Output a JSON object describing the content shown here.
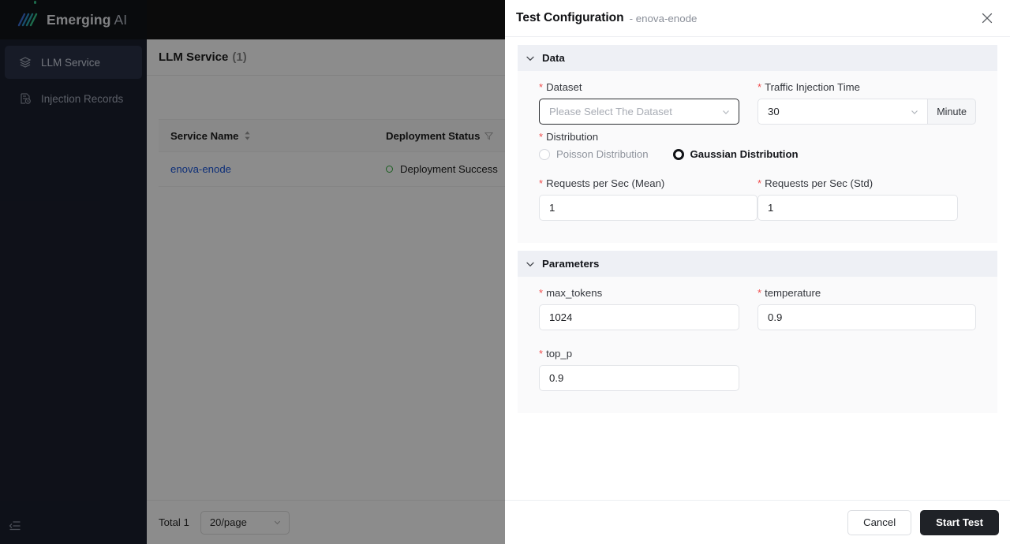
{
  "brand": {
    "name_bold": "Emerging",
    "name_light": "AI",
    "logo_icon": "slashes-logo-icon",
    "accent": "#35c58a"
  },
  "sidebar": {
    "items": [
      {
        "label": "LLM Service",
        "icon": "layers-icon",
        "active": true
      },
      {
        "label": "Injection Records",
        "icon": "document-clock-icon",
        "active": false
      }
    ],
    "collapse_icon": "sidebar-collapse-icon"
  },
  "page": {
    "title": "LLM Service",
    "count": "(1)",
    "table": {
      "columns": [
        {
          "label": "Service Name",
          "icon": "sort-icon"
        },
        {
          "label": "Deployment Status",
          "icon": "filter-icon"
        }
      ],
      "rows": [
        {
          "service_name": "enova-enode",
          "status": "Deployment Success",
          "status_color": "#2eab3a"
        }
      ]
    },
    "pagination": {
      "total": "Total 1",
      "page_size": "20/page",
      "chevron_icon": "chevron-down-icon"
    }
  },
  "modal": {
    "title": "Test Configuration",
    "subtitle": "- enova-enode",
    "close_icon": "close-icon",
    "sections": [
      {
        "key": "data",
        "title": "Data",
        "chevron_icon": "chevron-down-icon",
        "fields": {
          "dataset": {
            "label": "Dataset",
            "required": true,
            "placeholder": "Please Select The Dataset",
            "value": "",
            "chevron_icon": "chevron-down-icon"
          },
          "traffic_injection_time": {
            "label": "Traffic Injection Time",
            "required": true,
            "value": "30",
            "unit": "Minute",
            "chevron_icon": "chevron-down-icon"
          },
          "distribution": {
            "label": "Distribution",
            "required": true,
            "options": [
              {
                "label": "Poisson Distribution",
                "selected": false
              },
              {
                "label": "Gaussian Distribution",
                "selected": true
              }
            ]
          },
          "requests_mean": {
            "label": "Requests per Sec (Mean)",
            "required": true,
            "value": "1"
          },
          "requests_std": {
            "label": "Requests per Sec (Std)",
            "required": true,
            "value": "1"
          }
        }
      },
      {
        "key": "parameters",
        "title": "Parameters",
        "chevron_icon": "chevron-down-icon",
        "fields": {
          "max_tokens": {
            "label": "max_tokens",
            "required": true,
            "value": "1024"
          },
          "temperature": {
            "label": "temperature",
            "required": true,
            "value": "0.9"
          },
          "top_p": {
            "label": "top_p",
            "required": true,
            "value": "0.9"
          }
        }
      }
    ],
    "footer": {
      "cancel_label": "Cancel",
      "submit_label": "Start Test"
    }
  }
}
